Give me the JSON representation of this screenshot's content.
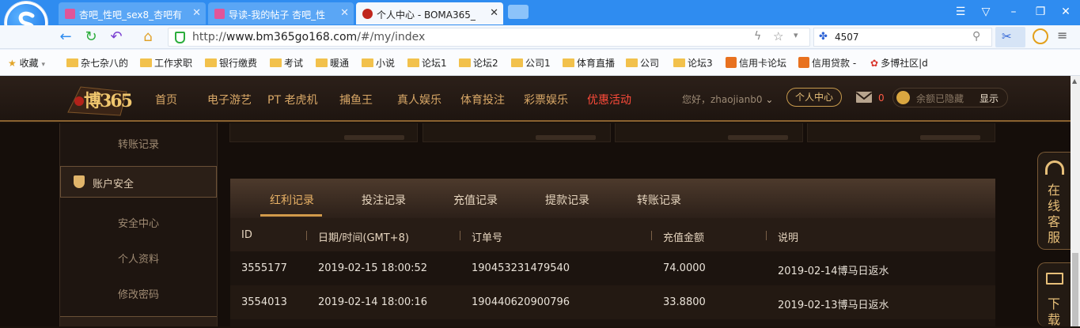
{
  "browser": {
    "tabs": [
      {
        "title": "杏吧_性吧_sex8_杏吧有"
      },
      {
        "title": "导读-我的帖子 杏吧_性"
      },
      {
        "title": "个人中心 - BOMA365_"
      }
    ],
    "url_prefix": "http://",
    "url_host": "www.bm365go168.com",
    "url_path": "/#/my/index",
    "search_value": "4507",
    "bookmarks": [
      "收藏",
      "杂七杂八的",
      "工作求职",
      "银行缴费",
      "考试",
      "暖通",
      "小说",
      "论坛1",
      "论坛2",
      "公司1",
      "体育直播",
      "公司",
      "论坛3",
      "信用卡论坛",
      "信用贷款 -",
      "多博社区|d"
    ]
  },
  "site": {
    "brand": "博365",
    "menu": [
      "首页",
      "电子游艺",
      "PT 老虎机",
      "捕鱼王",
      "真人娱乐",
      "体育投注",
      "彩票娱乐",
      "优惠活动"
    ],
    "greeting": "您好，zhaojianb0",
    "personal_center": "个人中心",
    "mail_count": "0",
    "balance_hidden": "余额已隐藏",
    "show_label": "显示"
  },
  "sidebar": {
    "transfer_record": "转账记录",
    "account_security": "账户安全",
    "security_center": "安全中心",
    "personal_info": "个人资料",
    "change_password": "修改密码"
  },
  "records": {
    "tabs": [
      "红利记录",
      "投注记录",
      "充值记录",
      "提款记录",
      "转账记录"
    ],
    "active_tab": 0,
    "columns": [
      "ID",
      "日期/时间(GMT+8)",
      "订单号",
      "充值金额",
      "说明"
    ],
    "rows": [
      [
        "3555177",
        "2019-02-15 18:00:52",
        "190453231479540",
        "74.0000",
        "2019-02-14博马日返水"
      ],
      [
        "3554013",
        "2019-02-14 18:00:16",
        "190440620900796",
        "33.8800",
        "2019-02-13博马日返水"
      ]
    ]
  },
  "float": {
    "service": "在线客服",
    "download": "下载"
  }
}
